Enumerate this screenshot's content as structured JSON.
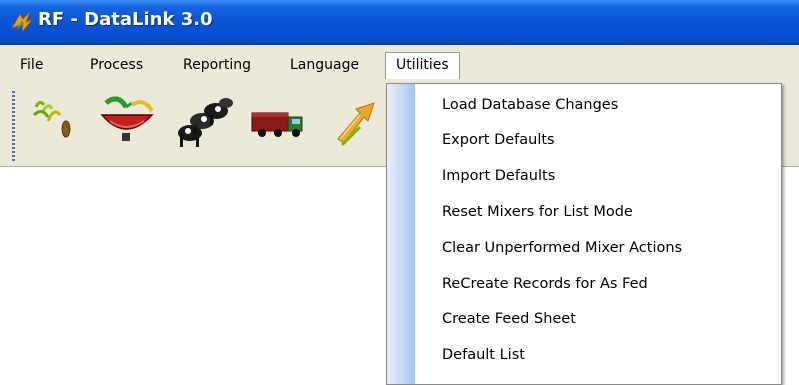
{
  "window": {
    "title": "RF - DataLink 3.0",
    "app_icon": "rf-logo-icon",
    "title_bar_color": "#0a54d6"
  },
  "menubar": {
    "items": [
      {
        "label": "File"
      },
      {
        "label": "Process"
      },
      {
        "label": "Reporting"
      },
      {
        "label": "Language"
      },
      {
        "label": "Utilities",
        "active": true
      }
    ]
  },
  "toolbar": {
    "buttons": [
      {
        "icon": "crop-plants-icon"
      },
      {
        "icon": "feed-mixer-icon"
      },
      {
        "icon": "cattle-herd-icon"
      },
      {
        "icon": "feed-truck-icon"
      },
      {
        "icon": "export-arrow-icon"
      }
    ]
  },
  "utilities_menu": {
    "items": [
      {
        "label": "Load Database Changes"
      },
      {
        "label": "Export Defaults"
      },
      {
        "label": "Import Defaults"
      },
      {
        "label": "Reset Mixers for List Mode"
      },
      {
        "label": "Clear Unperformed Mixer Actions"
      },
      {
        "label": "ReCreate Records for As Fed"
      },
      {
        "label": "Create Feed Sheet"
      },
      {
        "label": "Default List"
      }
    ]
  }
}
